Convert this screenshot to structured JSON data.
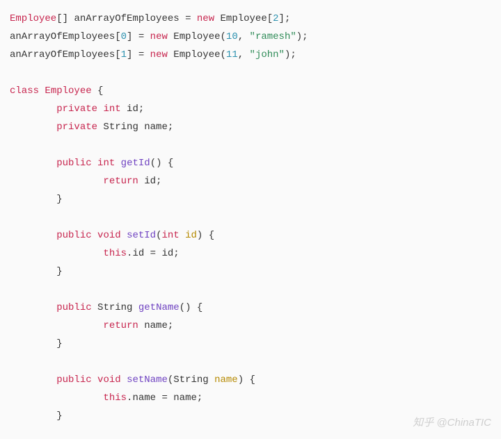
{
  "code": {
    "lines": [
      [
        {
          "cls": "tok-type",
          "t": "Employee"
        },
        {
          "cls": "tok-punct",
          "t": "[] "
        },
        {
          "cls": "tok-ident",
          "t": "anArrayOfEmployees "
        },
        {
          "cls": "tok-op",
          "t": "= "
        },
        {
          "cls": "tok-key",
          "t": "new"
        },
        {
          "cls": "tok-ident",
          "t": " Employee"
        },
        {
          "cls": "tok-punct",
          "t": "["
        },
        {
          "cls": "tok-num",
          "t": "2"
        },
        {
          "cls": "tok-punct",
          "t": "];"
        }
      ],
      [
        {
          "cls": "tok-ident",
          "t": "anArrayOfEmployees"
        },
        {
          "cls": "tok-punct",
          "t": "["
        },
        {
          "cls": "tok-num",
          "t": "0"
        },
        {
          "cls": "tok-punct",
          "t": "] "
        },
        {
          "cls": "tok-op",
          "t": "= "
        },
        {
          "cls": "tok-key",
          "t": "new"
        },
        {
          "cls": "tok-ident",
          "t": " Employee"
        },
        {
          "cls": "tok-punct",
          "t": "("
        },
        {
          "cls": "tok-num",
          "t": "10"
        },
        {
          "cls": "tok-punct",
          "t": ", "
        },
        {
          "cls": "tok-str",
          "t": "\"ramesh\""
        },
        {
          "cls": "tok-punct",
          "t": ");"
        }
      ],
      [
        {
          "cls": "tok-ident",
          "t": "anArrayOfEmployees"
        },
        {
          "cls": "tok-punct",
          "t": "["
        },
        {
          "cls": "tok-num",
          "t": "1"
        },
        {
          "cls": "tok-punct",
          "t": "] "
        },
        {
          "cls": "tok-op",
          "t": "= "
        },
        {
          "cls": "tok-key",
          "t": "new"
        },
        {
          "cls": "tok-ident",
          "t": " Employee"
        },
        {
          "cls": "tok-punct",
          "t": "("
        },
        {
          "cls": "tok-num",
          "t": "11"
        },
        {
          "cls": "tok-punct",
          "t": ", "
        },
        {
          "cls": "tok-str",
          "t": "\"john\""
        },
        {
          "cls": "tok-punct",
          "t": ");"
        }
      ],
      [],
      [
        {
          "cls": "tok-key",
          "t": "class"
        },
        {
          "cls": "tok-ident",
          "t": " "
        },
        {
          "cls": "tok-type",
          "t": "Employee"
        },
        {
          "cls": "tok-punct",
          "t": " {"
        }
      ],
      [
        {
          "cls": "tok-ident",
          "t": "        "
        },
        {
          "cls": "tok-key",
          "t": "private"
        },
        {
          "cls": "tok-ident",
          "t": " "
        },
        {
          "cls": "tok-type",
          "t": "int"
        },
        {
          "cls": "tok-ident",
          "t": " id;"
        }
      ],
      [
        {
          "cls": "tok-ident",
          "t": "        "
        },
        {
          "cls": "tok-key",
          "t": "private"
        },
        {
          "cls": "tok-ident",
          "t": " String name;"
        }
      ],
      [],
      [
        {
          "cls": "tok-ident",
          "t": "        "
        },
        {
          "cls": "tok-key",
          "t": "public"
        },
        {
          "cls": "tok-ident",
          "t": " "
        },
        {
          "cls": "tok-type",
          "t": "int"
        },
        {
          "cls": "tok-ident",
          "t": " "
        },
        {
          "cls": "tok-func",
          "t": "getId"
        },
        {
          "cls": "tok-punct",
          "t": "() {"
        }
      ],
      [
        {
          "cls": "tok-ident",
          "t": "                "
        },
        {
          "cls": "tok-key",
          "t": "return"
        },
        {
          "cls": "tok-ident",
          "t": " id;"
        }
      ],
      [
        {
          "cls": "tok-ident",
          "t": "        "
        },
        {
          "cls": "tok-punct",
          "t": "}"
        }
      ],
      [],
      [
        {
          "cls": "tok-ident",
          "t": "        "
        },
        {
          "cls": "tok-key",
          "t": "public"
        },
        {
          "cls": "tok-ident",
          "t": " "
        },
        {
          "cls": "tok-type",
          "t": "void"
        },
        {
          "cls": "tok-ident",
          "t": " "
        },
        {
          "cls": "tok-func",
          "t": "setId"
        },
        {
          "cls": "tok-punct",
          "t": "("
        },
        {
          "cls": "tok-type",
          "t": "int"
        },
        {
          "cls": "tok-ident",
          "t": " "
        },
        {
          "cls": "tok-param",
          "t": "id"
        },
        {
          "cls": "tok-punct",
          "t": ") {"
        }
      ],
      [
        {
          "cls": "tok-ident",
          "t": "                "
        },
        {
          "cls": "tok-type",
          "t": "this"
        },
        {
          "cls": "tok-punct",
          "t": "."
        },
        {
          "cls": "tok-ident",
          "t": "id "
        },
        {
          "cls": "tok-op",
          "t": "= "
        },
        {
          "cls": "tok-ident",
          "t": "id;"
        }
      ],
      [
        {
          "cls": "tok-ident",
          "t": "        "
        },
        {
          "cls": "tok-punct",
          "t": "}"
        }
      ],
      [],
      [
        {
          "cls": "tok-ident",
          "t": "        "
        },
        {
          "cls": "tok-key",
          "t": "public"
        },
        {
          "cls": "tok-ident",
          "t": " String "
        },
        {
          "cls": "tok-func",
          "t": "getName"
        },
        {
          "cls": "tok-punct",
          "t": "() {"
        }
      ],
      [
        {
          "cls": "tok-ident",
          "t": "                "
        },
        {
          "cls": "tok-key",
          "t": "return"
        },
        {
          "cls": "tok-ident",
          "t": " name;"
        }
      ],
      [
        {
          "cls": "tok-ident",
          "t": "        "
        },
        {
          "cls": "tok-punct",
          "t": "}"
        }
      ],
      [],
      [
        {
          "cls": "tok-ident",
          "t": "        "
        },
        {
          "cls": "tok-key",
          "t": "public"
        },
        {
          "cls": "tok-ident",
          "t": " "
        },
        {
          "cls": "tok-type",
          "t": "void"
        },
        {
          "cls": "tok-ident",
          "t": " "
        },
        {
          "cls": "tok-func",
          "t": "setName"
        },
        {
          "cls": "tok-punct",
          "t": "(String "
        },
        {
          "cls": "tok-param",
          "t": "name"
        },
        {
          "cls": "tok-punct",
          "t": ") {"
        }
      ],
      [
        {
          "cls": "tok-ident",
          "t": "                "
        },
        {
          "cls": "tok-type",
          "t": "this"
        },
        {
          "cls": "tok-punct",
          "t": "."
        },
        {
          "cls": "tok-ident",
          "t": "name "
        },
        {
          "cls": "tok-op",
          "t": "= "
        },
        {
          "cls": "tok-ident",
          "t": "name;"
        }
      ],
      [
        {
          "cls": "tok-ident",
          "t": "        "
        },
        {
          "cls": "tok-punct",
          "t": "}"
        }
      ]
    ]
  },
  "watermark": "知乎 @ChinaTIC"
}
